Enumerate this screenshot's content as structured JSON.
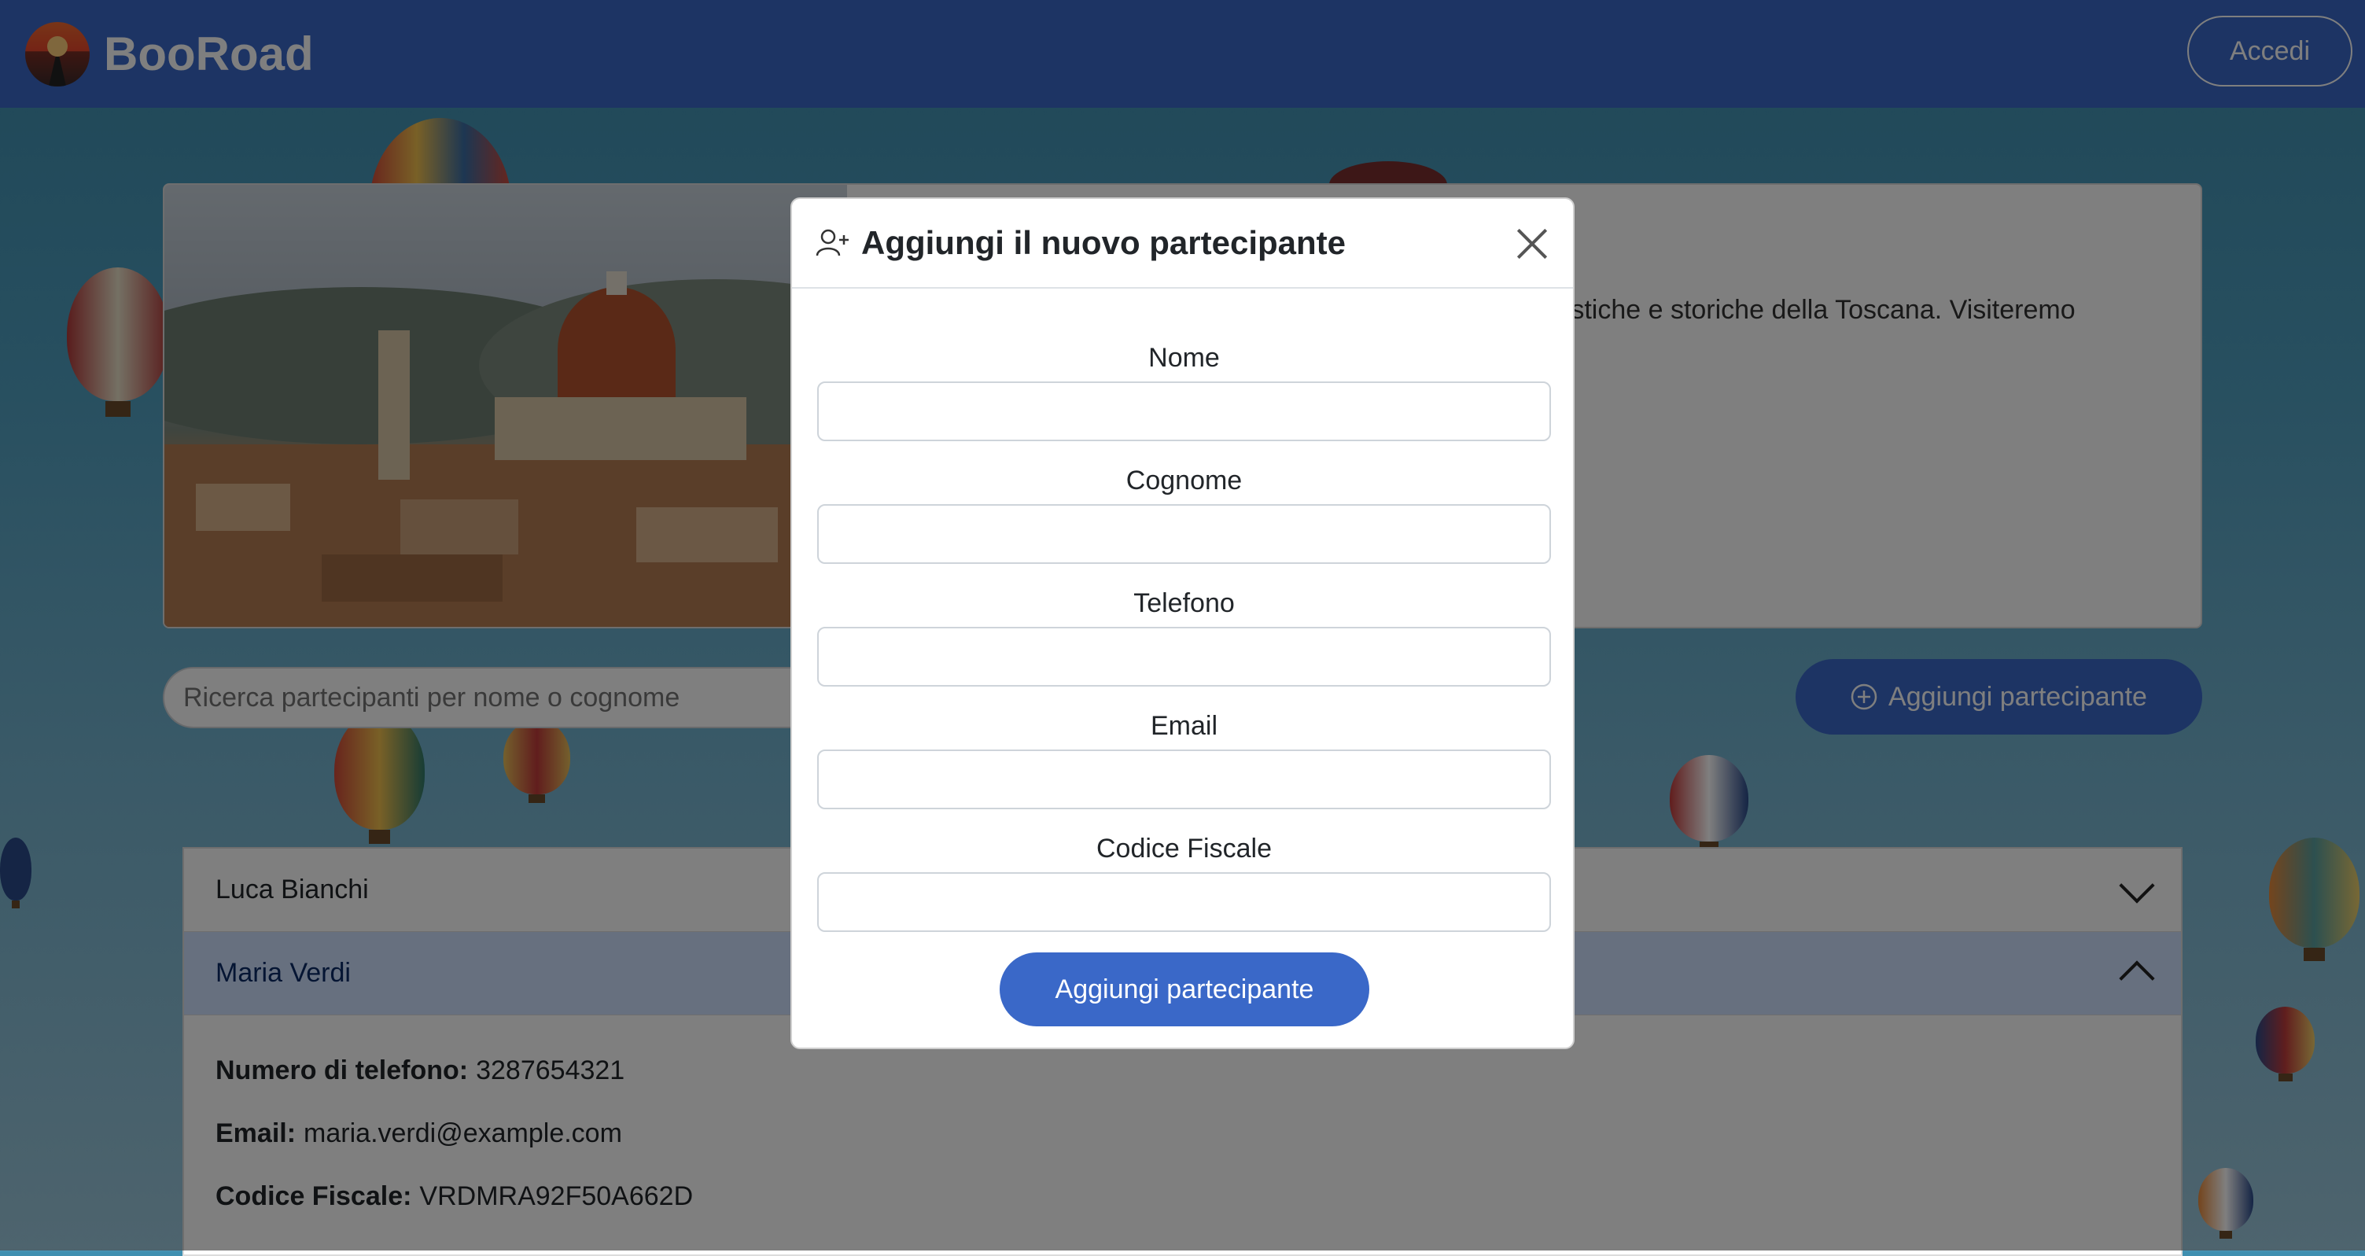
{
  "navbar": {
    "brand": "BooRoad",
    "login_label": "Accedi",
    "logo_icon": "road-sunset-logo-icon"
  },
  "trip": {
    "image_alt": "florence-cityscape",
    "description_fragment": "rtistiche e storiche della Toscana. Visiteremo"
  },
  "search": {
    "placeholder": "Ricerca partecipanti per nome o cognome"
  },
  "add_button": {
    "label": "Aggiungi partecipante",
    "icon": "plus-circle-icon"
  },
  "participants": [
    {
      "name": "Luca Bianchi",
      "expanded": false
    },
    {
      "name": "Maria Verdi",
      "expanded": true,
      "details": {
        "phone_label": "Numero di telefono:",
        "phone": "3287654321",
        "email_label": "Email:",
        "email": "maria.verdi@example.com",
        "cf_label": "Codice Fiscale:",
        "cf": "VRDMRA92F50A662D"
      }
    }
  ],
  "modal": {
    "title": "Aggiungi il nuovo partecipante",
    "title_icon": "person-add-icon",
    "fields": [
      {
        "label": "Nome",
        "value": ""
      },
      {
        "label": "Cognome",
        "value": ""
      },
      {
        "label": "Telefono",
        "value": ""
      },
      {
        "label": "Email",
        "value": ""
      },
      {
        "label": "Codice Fiscale",
        "value": ""
      }
    ],
    "submit_label": "Aggiungi partecipante"
  },
  "colors": {
    "primary": "#3a68c8",
    "accordion_open": "#cfe0ff",
    "sky": "#4f9fc0"
  }
}
